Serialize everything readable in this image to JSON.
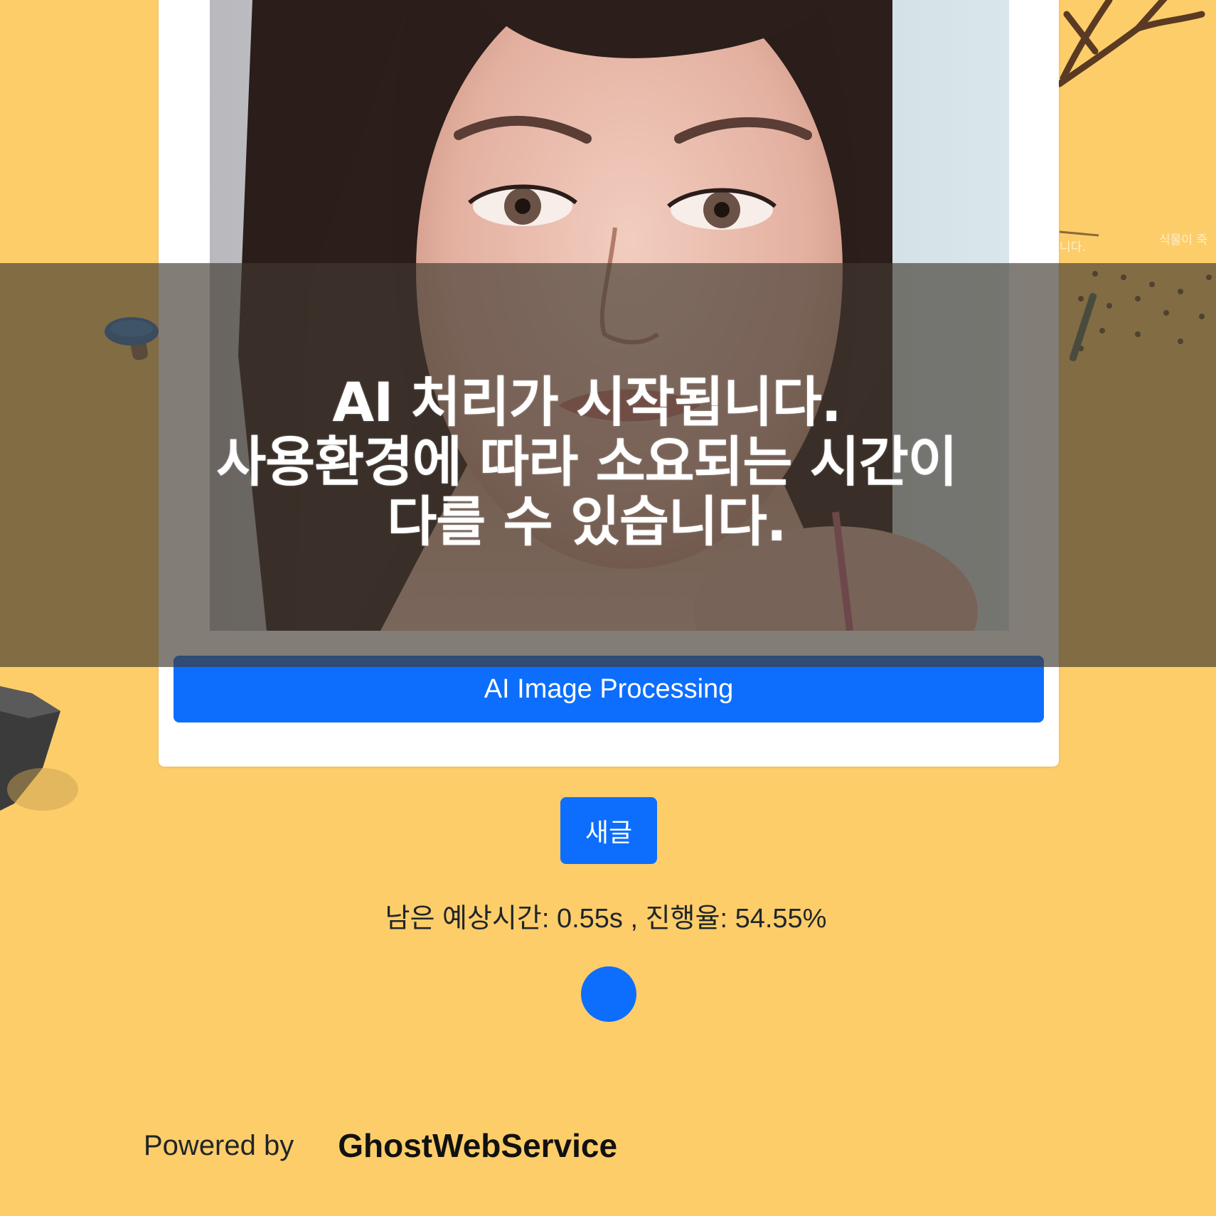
{
  "overlay": {
    "lines": [
      "AI 처리가 시작됩니다.",
      "사용환경에 따라 소요되는 시간이",
      "다를 수 있습니다."
    ]
  },
  "card": {
    "process_button_label": "AI Image Processing"
  },
  "actions": {
    "new_post_label": "새글"
  },
  "status": {
    "text": "남은 예상시간: 0.55s , 진행율: 54.55%",
    "remaining_time": "0.55s",
    "progress_percent": 54.55
  },
  "footer": {
    "powered_label": "Powered by",
    "brand": "GhostWebService"
  },
  "colors": {
    "background": "#fdcd6a",
    "accent": "#0d6efd",
    "overlay": "rgba(66,58,48,0.66)"
  }
}
